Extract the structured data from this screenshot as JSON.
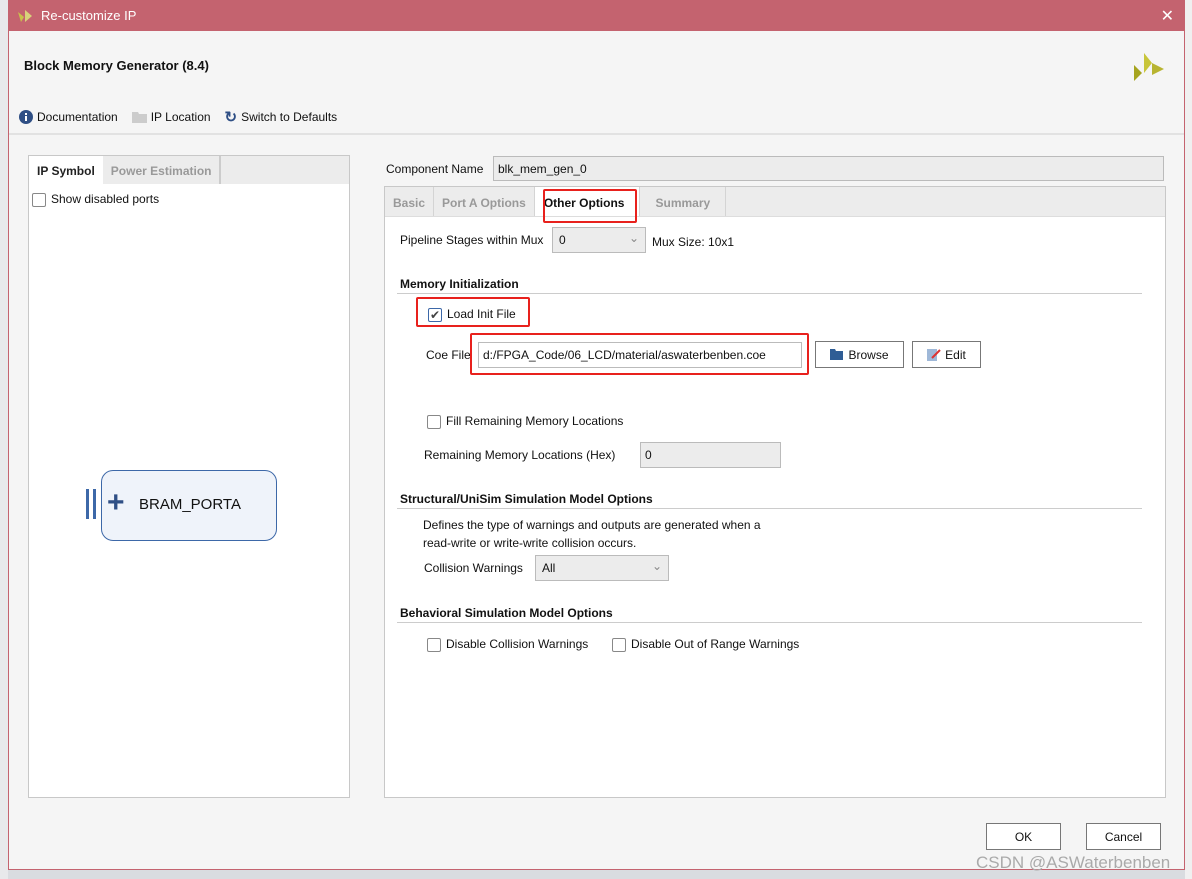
{
  "window": {
    "title": "Re-customize IP",
    "close": "✕"
  },
  "header": {
    "title": "Block Memory Generator (8.4)"
  },
  "toolbar": {
    "documentation": "Documentation",
    "ip_location": "IP Location",
    "switch_defaults": "Switch to Defaults"
  },
  "left_panel": {
    "tabs": [
      "IP Symbol",
      "Power Estimation"
    ],
    "show_disabled_ports": "Show disabled ports",
    "show_disabled_checked": false,
    "symbol_label": "BRAM_PORTA",
    "plus": "+"
  },
  "component": {
    "label": "Component Name",
    "value": "blk_mem_gen_0"
  },
  "tabs": [
    "Basic",
    "Port A Options",
    "Other Options",
    "Summary"
  ],
  "active_tab": "Other Options",
  "other": {
    "pipeline_label": "Pipeline Stages within Mux",
    "pipeline_value": "0",
    "mux_size": "Mux Size: 10x1",
    "mem_init": "Memory Initialization",
    "load_init": "Load Init File",
    "load_init_checked": true,
    "coe_label": "Coe File",
    "coe_value": "d:/FPGA_Code/06_LCD/material/aswaterbenben.coe",
    "browse": "Browse",
    "edit": "Edit",
    "fill_remaining": "Fill Remaining Memory Locations",
    "fill_checked": false,
    "remaining_label": "Remaining Memory Locations (Hex)",
    "remaining_value": "0",
    "structural": "Structural/UniSim Simulation Model Options",
    "desc1": "Defines the type of warnings and outputs are generated when a",
    "desc2": "read-write or write-write collision occurs.",
    "collision_label": "Collision Warnings",
    "collision_value": "All",
    "behavioral": "Behavioral Simulation Model Options",
    "disable_collision": "Disable Collision Warnings",
    "disable_oor": "Disable Out of Range Warnings"
  },
  "footer": {
    "ok": "OK",
    "cancel": "Cancel"
  },
  "watermark": "CSDN @ASWaterbenben",
  "colors": {
    "titlebar": "#c4636f",
    "highlight": "#e8211d",
    "symbol_border": "#3d68a8"
  }
}
